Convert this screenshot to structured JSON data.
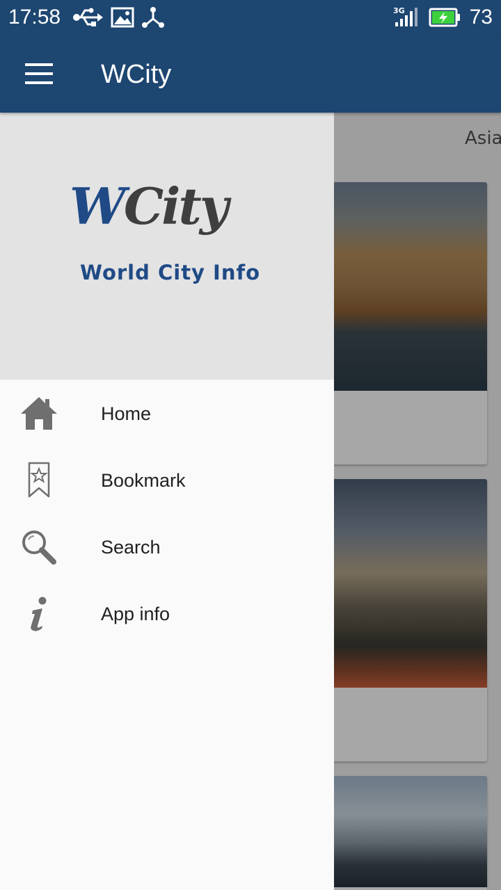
{
  "status_bar": {
    "time": "17:58",
    "icons": [
      "usb-icon",
      "image-icon",
      "share-node-icon",
      "signal-3g-icon",
      "battery-charging-icon"
    ],
    "network_label": "3G",
    "battery": "73"
  },
  "app_bar": {
    "title": "WCity",
    "menu_icon": "hamburger-menu-icon"
  },
  "drawer": {
    "logo": {
      "main_w": "W",
      "main_rest": "City",
      "tagline": "World City Info"
    },
    "items": [
      {
        "label": "Home",
        "icon": "home-icon"
      },
      {
        "label": "Bookmark",
        "icon": "bookmark-star-icon"
      },
      {
        "label": "Search",
        "icon": "search-icon"
      },
      {
        "label": "App info",
        "icon": "info-icon"
      }
    ]
  },
  "background": {
    "tab_hint": "Asia"
  },
  "colors": {
    "primary": "#1d4670",
    "drawer_header": "#e3e3e3",
    "drawer_bg": "#fafafa",
    "icon_gray": "#757575",
    "logo_blue": "#1f4a86"
  }
}
